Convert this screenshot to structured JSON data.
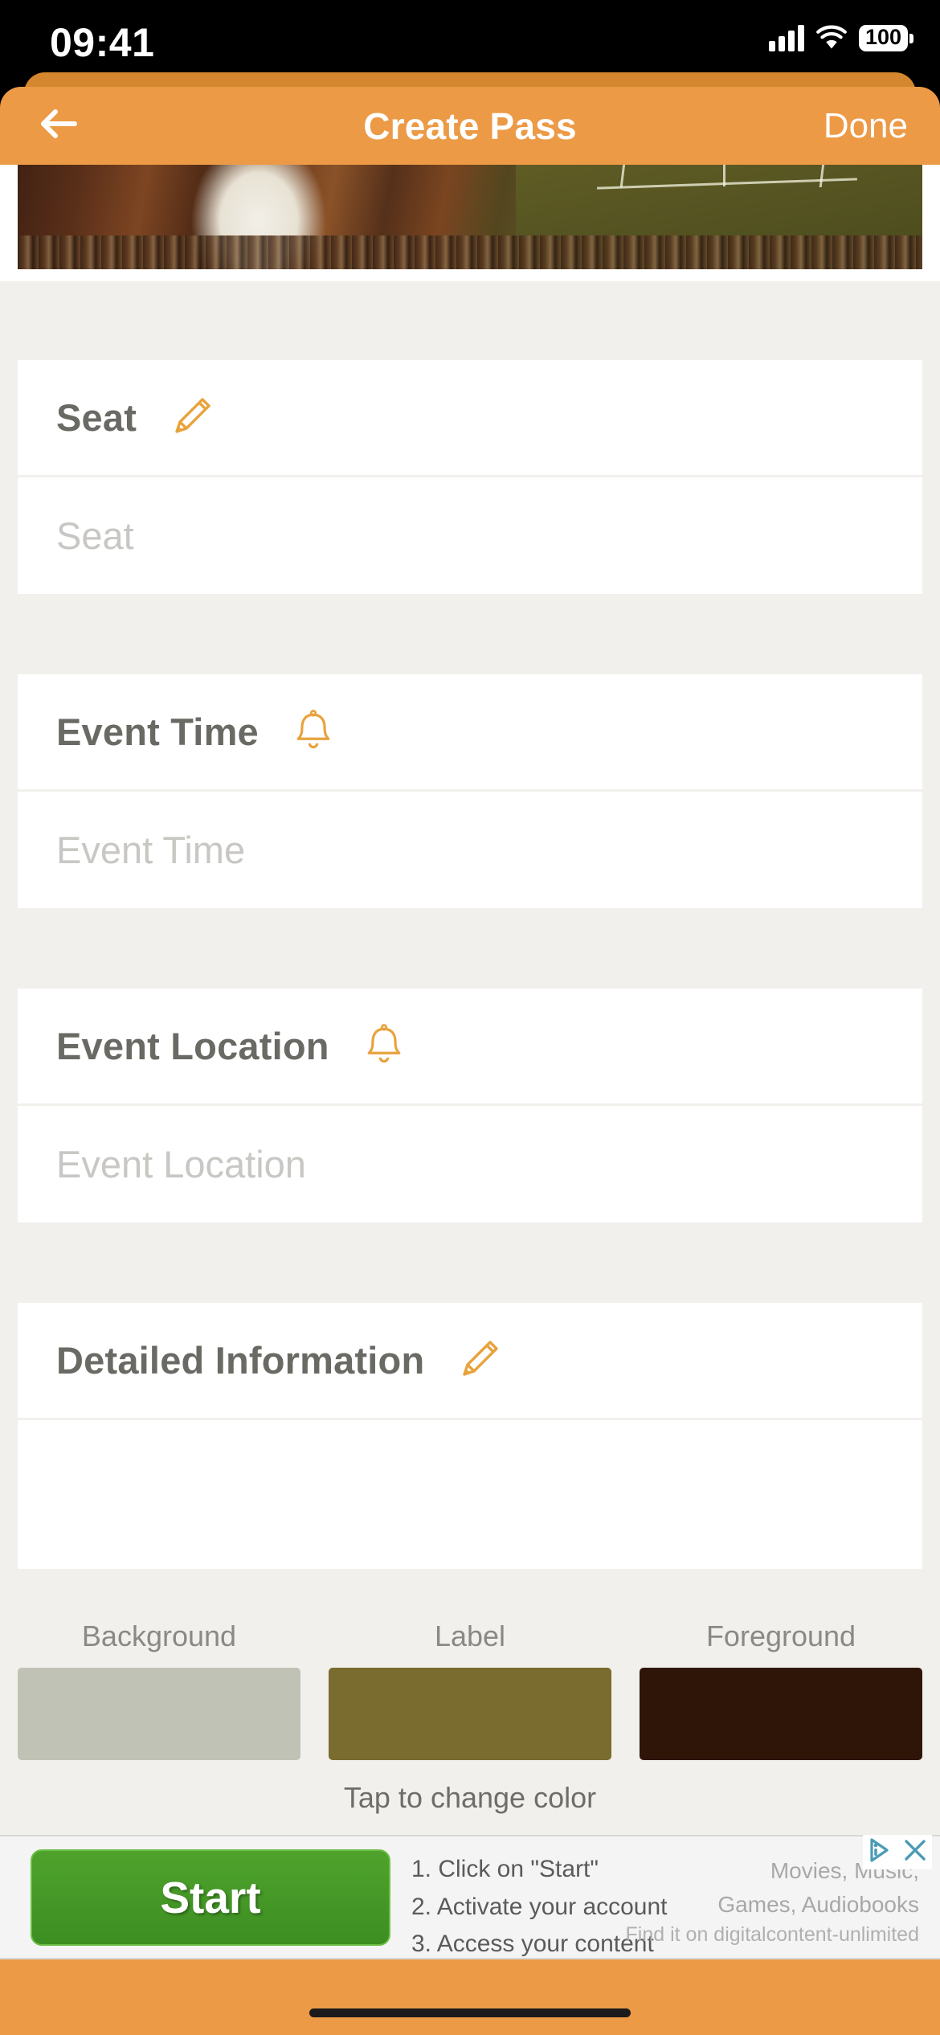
{
  "status_bar": {
    "time": "09:41",
    "battery_level": "100",
    "signal_icon": "cellular-signal-icon",
    "wifi_icon": "wifi-icon",
    "battery_icon": "battery-icon"
  },
  "nav": {
    "back_icon": "back-arrow-icon",
    "title": "Create Pass",
    "done_label": "Done"
  },
  "hero": {
    "alt": "tennis-stadium-photo"
  },
  "sections": [
    {
      "key": "seat",
      "label": "Seat",
      "icon": "pencil-icon",
      "placeholder": "Seat",
      "value": ""
    },
    {
      "key": "event_time",
      "label": "Event Time",
      "icon": "bell-icon",
      "placeholder": "Event Time",
      "value": ""
    },
    {
      "key": "event_location",
      "label": "Event Location",
      "icon": "bell-icon",
      "placeholder": "Event Location",
      "value": ""
    },
    {
      "key": "detailed_information",
      "label": "Detailed Information",
      "icon": "pencil-icon",
      "placeholder": "",
      "value": ""
    }
  ],
  "color_picker": {
    "hint": "Tap to change color",
    "swatches": [
      {
        "caption": "Background",
        "color": "#BFC2B5"
      },
      {
        "caption": "Label",
        "color": "#7A6B2E"
      },
      {
        "caption": "Foreground",
        "color": "#2E1508"
      }
    ]
  },
  "ad": {
    "start_label": "Start",
    "steps": [
      "1. Click on \"Start\"",
      "2. Activate your account",
      "3. Access your content"
    ],
    "right_line_1": "Movies, Music,",
    "right_line_2": "Games, Audiobooks",
    "footer": "Find it on digitalcontent-unlimited",
    "info_icon": "adchoices-icon",
    "close_icon": "close-icon"
  },
  "theme": {
    "accent": "#EC9A46",
    "accent_dark": "#D4872F",
    "page_bg": "#F2F0ED",
    "card_bg": "#FFFFFF",
    "label_text": "#6A6A65",
    "placeholder_text": "#C9C7C4"
  }
}
